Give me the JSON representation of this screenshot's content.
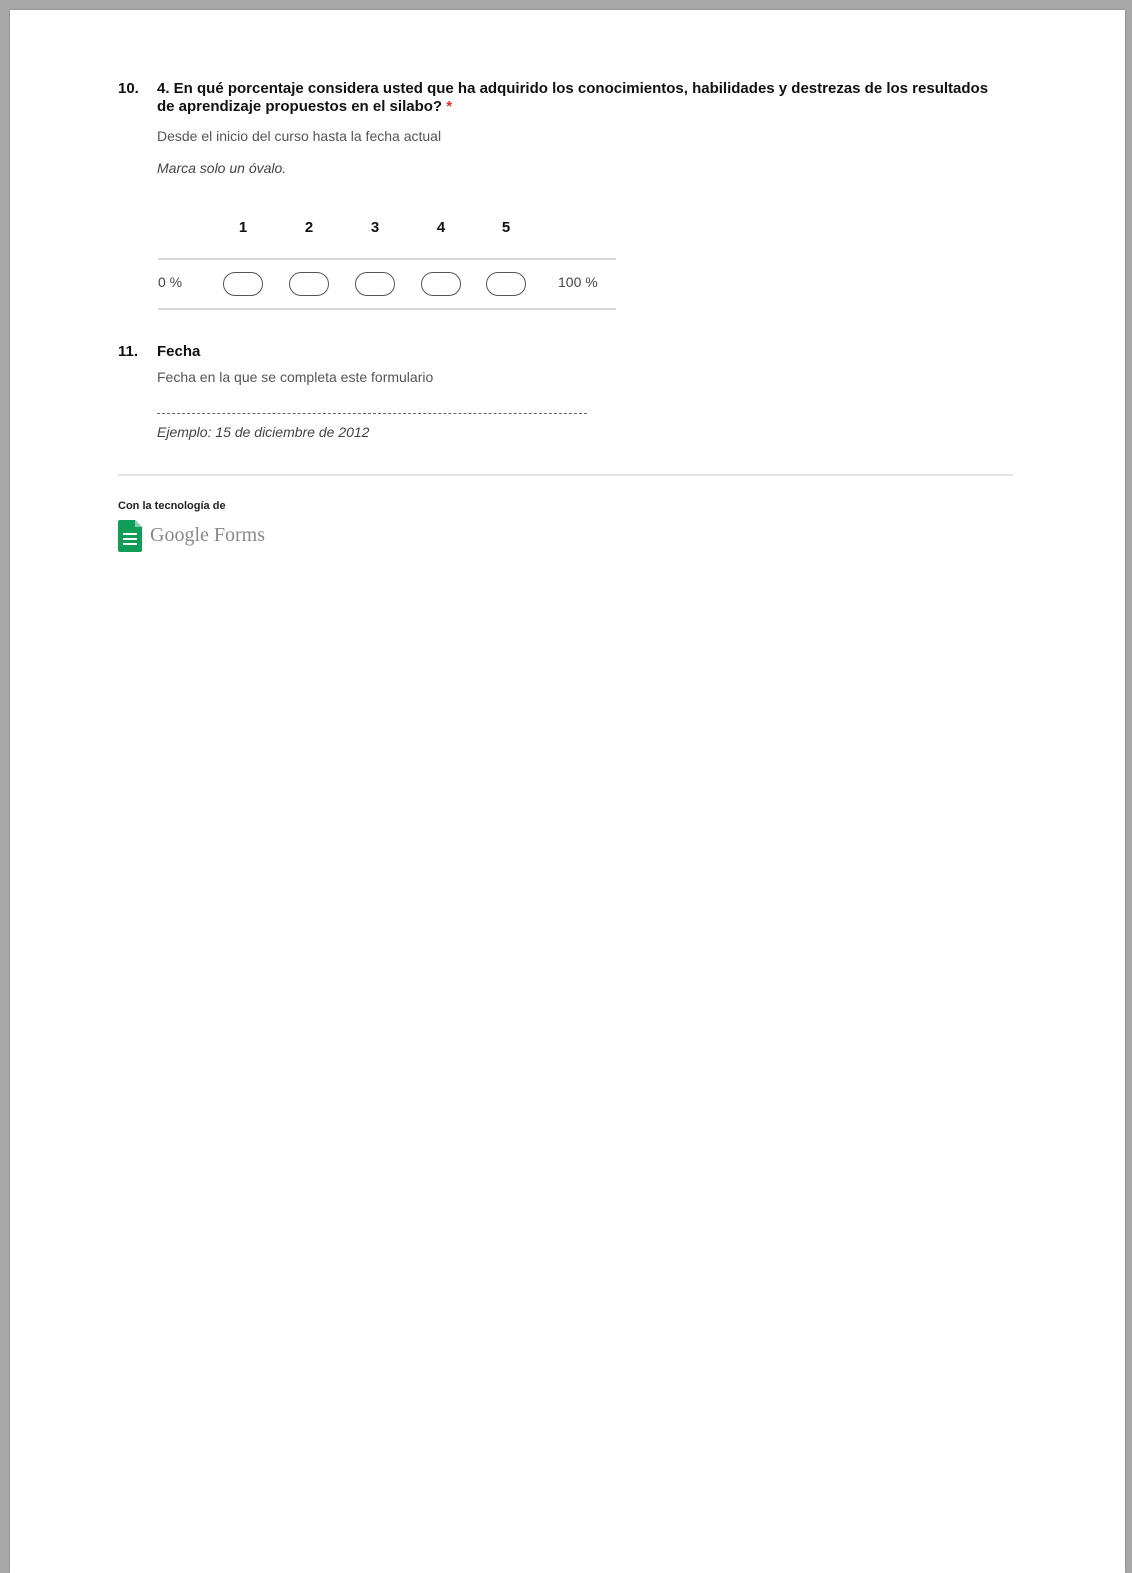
{
  "questions": [
    {
      "number": "10.",
      "title": "4. En qué porcentaje considera usted que ha adquirido los conocimientos, habilidades y destrezas de los resultados de aprendizaje propuestos en el silabo?",
      "required_mark": "*",
      "description": "Desde el inicio del curso hasta la fecha actual",
      "instruction": "Marca solo un óvalo.",
      "scale": {
        "options": [
          "1",
          "2",
          "3",
          "4",
          "5"
        ],
        "low_label": "0 %",
        "high_label": "100 %"
      }
    },
    {
      "number": "11.",
      "title": "Fecha",
      "description": "Fecha en la que se completa este formulario",
      "example": "Ejemplo: 15 de diciembre de 2012"
    }
  ],
  "footer": {
    "powered_by": "Con la tecnología de",
    "logo_text": "Google Forms",
    "logo_color": "#0f9d58"
  }
}
